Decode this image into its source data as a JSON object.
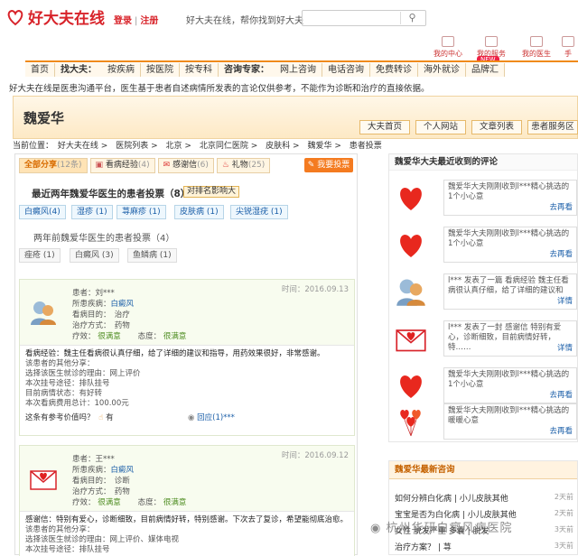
{
  "site": {
    "name": "好大夫在线",
    "login": "登录",
    "register": "注册",
    "slogan": "好大夫在线，帮你找到好大夫"
  },
  "quick_links": [
    "我的中心",
    "我的服务",
    "我的医生",
    "手"
  ],
  "new_badge": "NEW",
  "nav": [
    "首页",
    "找大夫：",
    "按疾病",
    "按医院",
    "按专科",
    "咨询专家：",
    "网上咨询",
    "电话咨询",
    "免费转诊",
    "海外就诊",
    "品牌汇"
  ],
  "disclaimer": "好大夫在线是医患沟通平台，医生基于患者自述病情所发表的言论仅供参考，不能作为诊断和治疗的直接依据。",
  "doctor": {
    "name": "魏爱华",
    "tabs": [
      "大夫首页",
      "个人网站",
      "文章列表",
      "患者服务区"
    ]
  },
  "breadcrumb": [
    "当前位置：",
    "好大夫在线",
    "医院列表",
    "北京",
    "北京同仁医院",
    "皮肤科",
    "魏爱华",
    "患者投票"
  ],
  "left_tabs": [
    {
      "label": "全部分享",
      "count": "(12条)"
    },
    {
      "label": "看病经验",
      "count": "(4)"
    },
    {
      "label": "感谢信",
      "count": "(6)"
    },
    {
      "label": "礼物",
      "count": "(25)"
    }
  ],
  "vote_button": "我要投票",
  "recent_title": "最近两年魏爱华医生的患者投票（8）",
  "rank_label": "对排名影响大",
  "recent_pills": [
    "白癜风(4)",
    "湿疹 (1)",
    "荨麻疹 (1)",
    "皮肤病 (1)",
    "尖锐湿疣 (1)"
  ],
  "older_title": "两年前魏爱华医生的患者投票（4）",
  "older_pills": [
    "痤疮 (1)",
    "白癜风 (3)",
    "鱼鳞病 (1)"
  ],
  "card1": {
    "time": "时间：2016.09.13",
    "patient": "患者：刘***",
    "disease_label": "所患疾病：",
    "disease": "白癜风",
    "purpose": "看病目的：　治疗",
    "method": "治疗方式：　药物",
    "effect_label": "疗效：",
    "effect": "很满意",
    "attitude_label": "态度：",
    "attitude": "很满意",
    "lines": [
      "看病经验：魏主任看病很认真仔细，给了详细的建议和指导，用药效果很好，非常感谢。",
      "该患者的其他分享：",
      "选择该医生就诊的理由：网上评价",
      "本次挂号途径：排队挂号",
      "目前病情状态：有好转",
      "本次看病费用总计：100.00元"
    ],
    "useful": "这条有参考价值吗？",
    "yes": "有",
    "reply": "回应(1)***"
  },
  "card2": {
    "time": "时间：2016.09.12",
    "patient": "患者：王***",
    "disease_label": "所患疾病：",
    "disease": "白癜风",
    "purpose": "看病目的：　诊断",
    "method": "治疗方式：　药物",
    "effect_label": "疗效：",
    "effect": "很满意",
    "attitude_label": "态度：",
    "attitude": "很满意",
    "lines": [
      "感谢信：特别有爱心，诊断细致，目前病情好转，特别感谢。下次去了复诊，希望能彻底治愈。",
      "该患者的其他分享：",
      "选择该医生就诊的理由：网上评价、媒体电视",
      "本次挂号途径：排队挂号"
    ]
  },
  "right": {
    "title": "魏爱华大夫最近收到的评论",
    "items": [
      {
        "text": "魏爱华大夫刚刚收到l***精心挑选的1个小心意",
        "link": "去再看"
      },
      {
        "text": "魏爱华大夫刚刚收到l***精心挑选的1个小心意",
        "link": "去再看"
      },
      {
        "text": "l*** 发表了一篇 看病经验 魏主任看病很认真仔细，给了详细的建议和",
        "link": "详情"
      },
      {
        "text": "l*** 发表了一封 感谢信 特别有爱心，诊断细致，目前病情好转，特……",
        "link": "详情"
      },
      {
        "text": "魏爱华大夫刚刚收到l***精心挑选的1个小心意",
        "link": "去再看"
      },
      {
        "text": "魏爱华大夫刚刚收到l***精心挑选的暖暖心意",
        "link": "去再看"
      }
    ]
  },
  "right2": {
    "title": "魏爱华最新咨询",
    "items": [
      {
        "text": "如何分辨白化病 | 小儿皮肤其他",
        "time": "2天前"
      },
      {
        "text": "宝宝是否为白化病 | 小儿皮肤其他",
        "time": "2天前"
      },
      {
        "text": "女性 脱发严重 多囊 | 脱发",
        "time": "3天前"
      },
      {
        "text": "治疗方案？ | 荨",
        "time": "3天前"
      }
    ]
  },
  "watermark": "杭州华研白癜风病医院",
  "colors": {
    "brand": "#d8232a",
    "accent": "#f47b20",
    "link": "#1a5ea8"
  }
}
